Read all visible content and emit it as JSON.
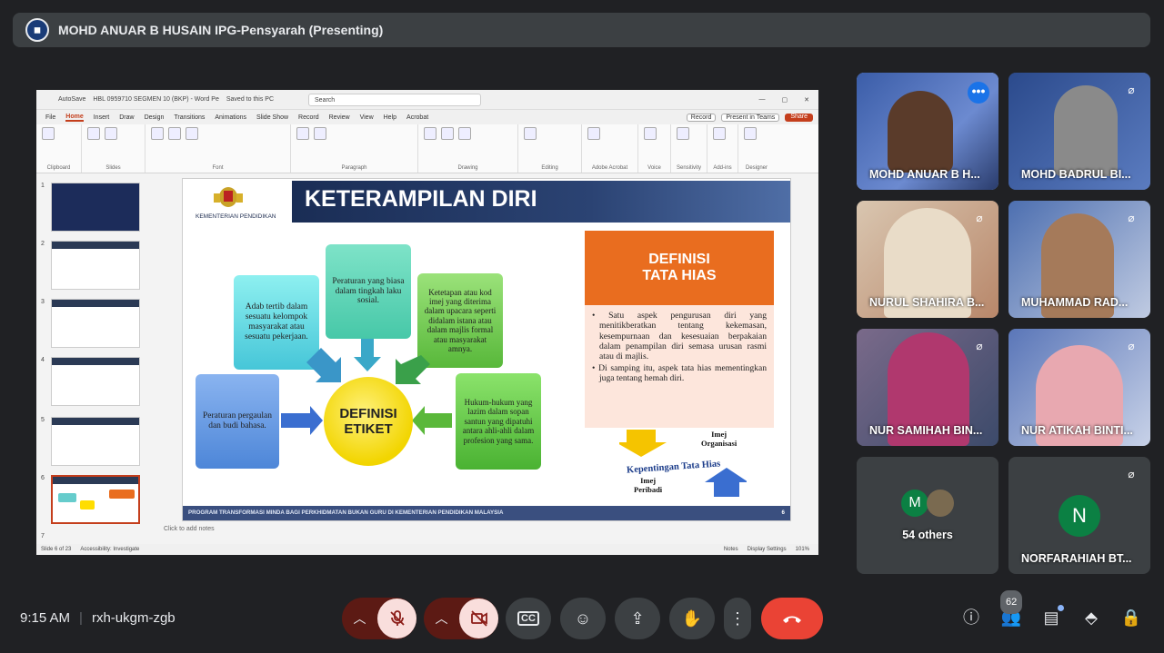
{
  "presenter": {
    "name": "MOHD ANUAR B HUSAIN IPG-Pensyarah (Presenting)"
  },
  "ppt": {
    "doc_title": "HBL 0959710 SEGMEN 10 (BKP) - Word Pe",
    "saved": "Saved to this PC",
    "search_placeholder": "Search",
    "autosave": "AutoSave",
    "menu": [
      "File",
      "Home",
      "Insert",
      "Draw",
      "Design",
      "Transitions",
      "Animations",
      "Slide Show",
      "Record",
      "Review",
      "View",
      "Help",
      "Acrobat"
    ],
    "record_btn": "Record",
    "present_btn": "Present in Teams",
    "share_btn": "Share",
    "ribbon_groups": [
      "Clipboard",
      "Slides",
      "Font",
      "Paragraph",
      "Drawing",
      "Editing",
      "Adobe Acrobat",
      "Voice",
      "Sensitivity",
      "Add-ins",
      "Designer"
    ],
    "notes_placeholder": "Click to add notes",
    "status_slide": "Slide 6 of 23",
    "status_accessibility": "Accessibility: Investigate",
    "status_notes": "Notes",
    "status_display": "Display Settings",
    "zoom": "101%"
  },
  "slide": {
    "ministry": "KEMENTERIAN PENDIDIKAN",
    "title": "KETERAMPILAN DIRI",
    "center": "DEFINISI ETIKET",
    "boxes": {
      "top": "Peraturan yang biasa dalam tingkah laku sosial.",
      "top_left": "Adab tertib dalam sesuatu kelompok masyarakat atau sesuatu pekerjaan.",
      "top_right": "Ketetapan atau kod imej yang diterima dalam upacara seperti didalam istana atau dalam majlis formal atau masyarakat amnya.",
      "left": "Peraturan pergaulan dan budi bahasa.",
      "right": "Hukum-hukum yang lazim dalam sopan santun yang dipatuhi antara ahli-ahli dalam profesion yang sama."
    },
    "def_title_1": "DEFINISI",
    "def_title_2": "TATA HIAS",
    "def_p1": "Satu aspek pengurusan diri yang menitikberatkan tentang kekemasan, kesempurnaan dan kesesuaian berpakaian dalam penampilan diri semasa urusan rasmi atau di majlis.",
    "def_p2": "Di samping itu, aspek tata hias mementingkan juga tentang hemah diri.",
    "imej_org_1": "Imej",
    "imej_org_2": "Organisasi",
    "kepentingan": "Kepentingan Tata Hias",
    "imej_per_1": "Imej",
    "imej_per_2": "Peribadi",
    "footer": "PROGRAM TRANSFORMASI MINDA BAGI PERKHIDMATAN BUKAN GURU DI KEMENTERIAN PENDIDIKAN MALAYSIA",
    "number": "6"
  },
  "participants": [
    {
      "name": "MOHD ANUAR B H...",
      "bg": "#3b5da8"
    },
    {
      "name": "MOHD BADRUL BI...",
      "bg": "#2b4a8c"
    },
    {
      "name": "NURUL SHAHIRA B...",
      "bg": "#b8876a"
    },
    {
      "name": "MUHAMMAD RAD...",
      "bg": "#4d6fb0"
    },
    {
      "name": "NUR SAMIHAH BIN...",
      "bg": "#6a5a7a"
    },
    {
      "name": "NUR ATIKAH BINTI...",
      "bg": "#5a76b8"
    },
    {
      "name": "54 others",
      "initial": "M"
    },
    {
      "name": "NORFARAHIAH BT...",
      "initial": "N"
    }
  ],
  "meeting": {
    "time": "9:15 AM",
    "code": "rxh-ukgm-zgb",
    "people_count": "62"
  },
  "colors": {
    "end_call": "#ea4335",
    "mic_off_bg": "#f9dedc",
    "tile_bg": "#3c4043",
    "accent": "#8ab4f8"
  }
}
